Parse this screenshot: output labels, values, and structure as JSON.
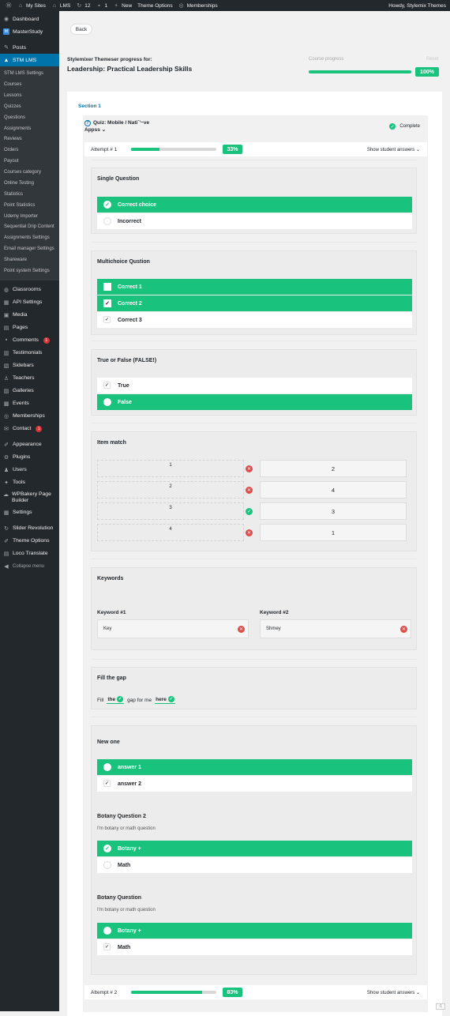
{
  "adminbar": {
    "wp_logo": "wordpress-icon",
    "items": [
      "My Sites",
      "LMS",
      "12",
      "1",
      "New",
      "Theme Options",
      "Memberships"
    ],
    "howdy": "Howdy, Stylemix Themes"
  },
  "sidebar": {
    "top": [
      "Dashboard",
      "MasterStudy"
    ],
    "posts": "Posts",
    "active": "STM LMS",
    "sub": [
      "STM LMS Settings",
      "Courses",
      "Lessons",
      "Quizzes",
      "Questions",
      "Assignments",
      "Reviews",
      "Orders",
      "Payout",
      "Courses category",
      "Online Testing",
      "Statistics",
      "Point Statistics",
      "Udemy Importer",
      "Sequential Drip Content",
      "Assignments Settings",
      "Email manager Settings",
      "Shareware",
      "Point system Settings"
    ],
    "items": [
      "Classrooms",
      "API Settings",
      "Media",
      "Pages",
      "Comments",
      "Testimonials",
      "Sidebars",
      "Teachers",
      "Galleries",
      "Events",
      "Memberships",
      "Contact"
    ],
    "comments_badge": "1",
    "contact_badge": "1",
    "items2": [
      "Appearance",
      "Plugins",
      "Users",
      "Tools",
      "WPBakery Page Builder",
      "Settings"
    ],
    "items3": [
      "Slider Revolution",
      "Theme Options",
      "Loco Translate"
    ],
    "collapse": "Collapse menu"
  },
  "header": {
    "back": "Back",
    "subtitle": "Stylemixer Themeser progress for:",
    "title": "Leadership: Practical Leadership Skills",
    "progress_label": "Course progress",
    "reset": "Reset",
    "progress_pct": "100%",
    "progress_value": 1.0
  },
  "section": "Section 1",
  "quiz": {
    "title_line1": "Quiz: Mobile / Nati`'~ve",
    "title_line2": "Appss",
    "status": "Complete"
  },
  "attempt1": {
    "label": "Attempt # 1",
    "pct": "33%",
    "value": 0.33,
    "toggle": "Show student answers"
  },
  "attempt2": {
    "label": "Attempt # 2",
    "pct": "83%",
    "value": 0.83,
    "toggle": "Show student answers"
  },
  "q_single": {
    "title": "Single Question",
    "answers": [
      "Correct choice",
      "Incorrect"
    ]
  },
  "q_multi": {
    "title": "Multichoice Qustion",
    "answers": [
      "Correct 1",
      "Correct 2",
      "Correct 3"
    ]
  },
  "q_tf": {
    "title": "True or False (FALSE!)",
    "answers": [
      "True",
      "False"
    ]
  },
  "q_match": {
    "title": "Item match",
    "left": [
      "1",
      "2",
      "3",
      "4"
    ],
    "right": [
      "2",
      "4",
      "3",
      "1"
    ],
    "status": [
      "wrong",
      "wrong",
      "correct",
      "wrong"
    ]
  },
  "q_keywords": {
    "title": "Keywords",
    "k1_label": "Keyword #1",
    "k1_value": "Key",
    "k2_label": "Keyword #2",
    "k2_value": "Shmey"
  },
  "q_fill": {
    "title": "Fill the gap",
    "w1": "Fill",
    "g1": "the",
    "w2": "gap for me",
    "g2": "here"
  },
  "q_new": {
    "title": "New one",
    "answers": [
      "answer 1",
      "answer 2"
    ]
  },
  "q_botany2": {
    "title": "Botany Question 2",
    "desc": "I'm botany or math question",
    "answers": [
      "Botany +",
      "Math"
    ]
  },
  "q_botany": {
    "title": "Botany Question",
    "desc": "I'm botany or math question",
    "answers": [
      "Botany +",
      "Math"
    ]
  },
  "colors": {
    "accent": "#19c37d",
    "wp_blue": "#0073aa",
    "wrong": "#e04b4b"
  }
}
